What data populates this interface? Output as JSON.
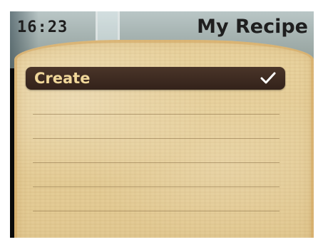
{
  "status": {
    "time": "16:23"
  },
  "header": {
    "title": "My Recipe"
  },
  "menu": {
    "items": [
      {
        "label": "Create",
        "selected": true,
        "icon": "checkmark-icon"
      }
    ],
    "empty_rows": 5
  },
  "colors": {
    "selection_bg": "#3b2a20",
    "selection_text": "#f0d79a",
    "bread": "#e6cf9a"
  }
}
